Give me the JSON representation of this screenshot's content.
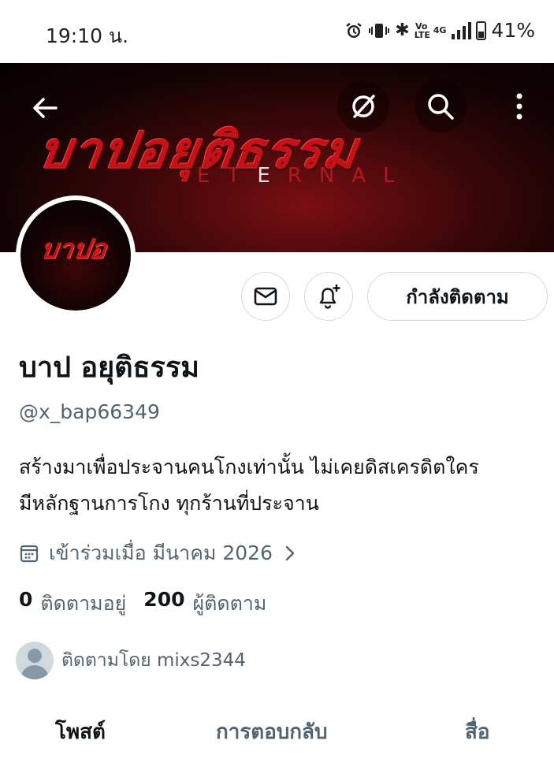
{
  "status_bar": {
    "time": "19:10 น.",
    "volte": "Vo LTE",
    "network": "4G",
    "battery_percent": "41%",
    "icons": [
      "alarm-icon",
      "vibrate-icon",
      "bluetooth-icon",
      "volte-icon",
      "signal-icon",
      "battery-icon"
    ]
  },
  "banner": {
    "title": "บาปอยุติธรรม",
    "subtitle_parts": [
      "ET",
      "E",
      "R",
      "N",
      "AL"
    ]
  },
  "nav": {
    "icons": [
      "back-arrow-icon",
      "grok-icon",
      "search-icon",
      "more-vertical-icon"
    ]
  },
  "avatar": {
    "text": "บาปอ"
  },
  "actions": {
    "follow_label": "กำลังติดตาม",
    "icons": [
      "mail-icon",
      "bell-plus-icon"
    ]
  },
  "profile": {
    "display_name": "บาป อยุติธรรม",
    "handle": "@x_bap66349",
    "bio_line1": "สร้างมาเพื่อประจานคนโกงเท่านั้น ไม่เคยดิสเครดิตใคร",
    "bio_line2": "มีหลักฐานการโกง ทุกร้านที่ประจาน",
    "joined": "เข้าร่วมเมื่อ มีนาคม 2026",
    "following_count": "0",
    "following_label": "ติดตามอยู่",
    "followers_count": "200",
    "followers_label": "ผู้ติดตาม",
    "followed_by": "ติดตามโดย mixs2344"
  },
  "tabs": {
    "posts": "โพสต์",
    "replies": "การตอบกลับ",
    "media": "สื่อ"
  }
}
